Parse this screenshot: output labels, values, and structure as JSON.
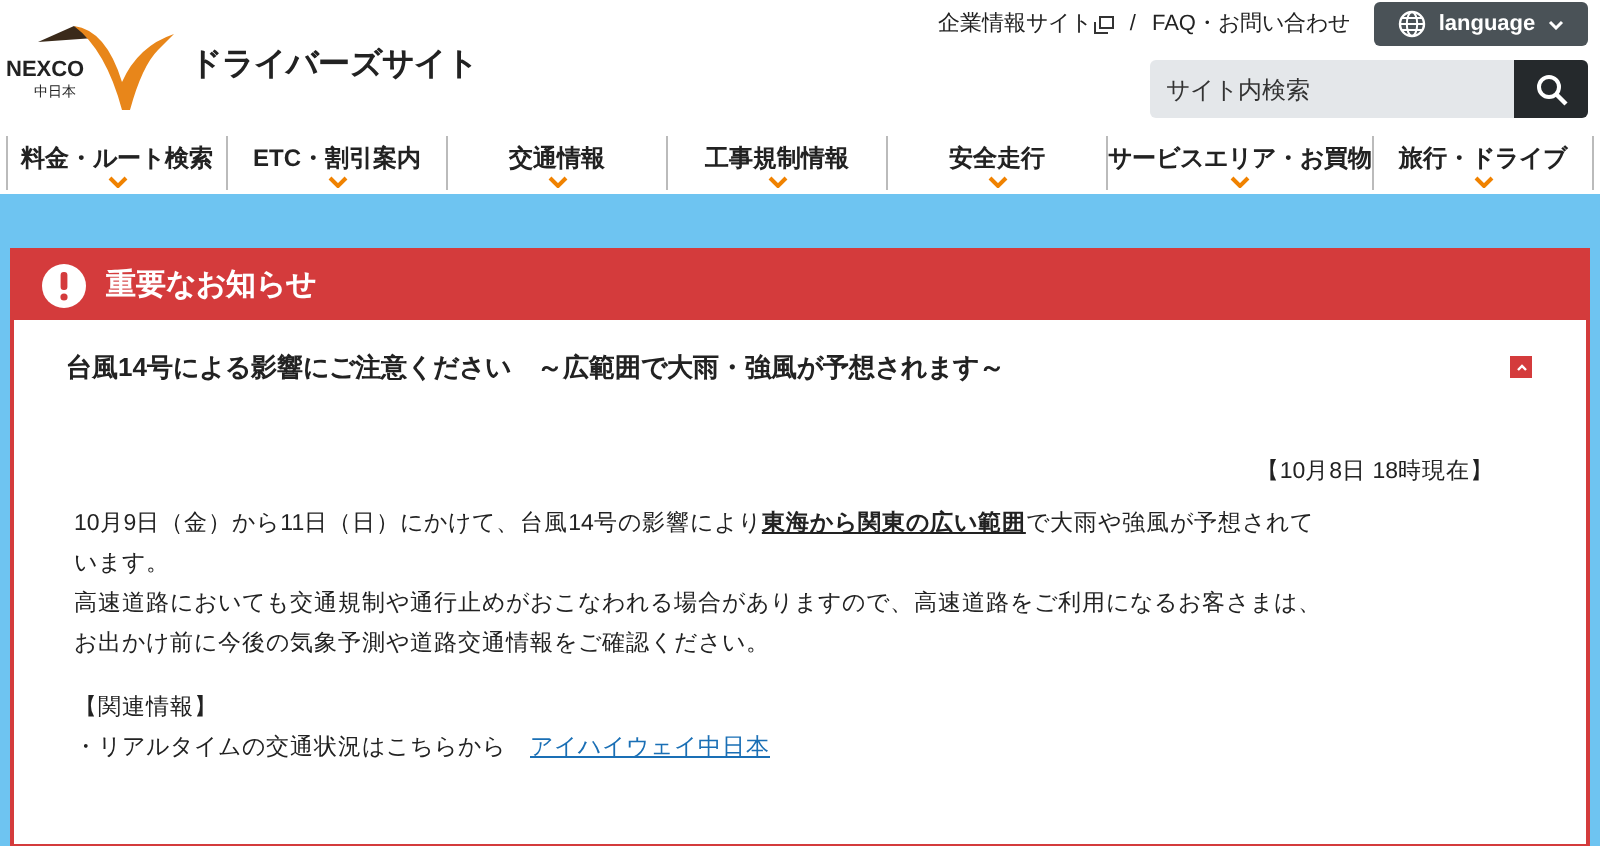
{
  "header": {
    "site_title": "ドライバーズサイト",
    "logo": {
      "brand": "NEXCO",
      "sub": "中日本"
    },
    "top_links_separator": "/",
    "top_links": [
      {
        "label": "企業情報サイト",
        "external": true
      },
      {
        "label": "FAQ・お問い合わせ",
        "external": false
      }
    ],
    "language_button": "language",
    "search": {
      "placeholder": "サイト内検索"
    }
  },
  "nav": [
    {
      "label": "料金・ルート検索"
    },
    {
      "label": "ETC・割引案内"
    },
    {
      "label": "交通情報"
    },
    {
      "label": "工事規制情報"
    },
    {
      "label": "安全走行"
    },
    {
      "label": "サービスエリア・お買物"
    },
    {
      "label": "旅行・ドライブ"
    }
  ],
  "notice": {
    "heading": "重要なお知らせ",
    "title": "台風14号による影響にご注意ください　～広範囲で大雨・強風が予想されます～",
    "expanded": true,
    "timestamp": "【10月8日 18時現在】",
    "paragraphs": [
      "10月9日（金）から11日（日）にかけて、台風14号の影響により**東海から関東の広い範囲**で大雨や強風が予想されています。",
      "高速道路においても交通規制や通行止めがおこなわれる場合がありますので、高速道路をご利用になるお客さまは、お出かけ前に今後の気象予測や道路交通情報をご確認ください。"
    ],
    "related_heading": "【関連情報】",
    "related": [
      {
        "text": "・リアルタイムの交通状況はこちらから",
        "link": "アイハイウェイ中日本"
      }
    ]
  }
}
